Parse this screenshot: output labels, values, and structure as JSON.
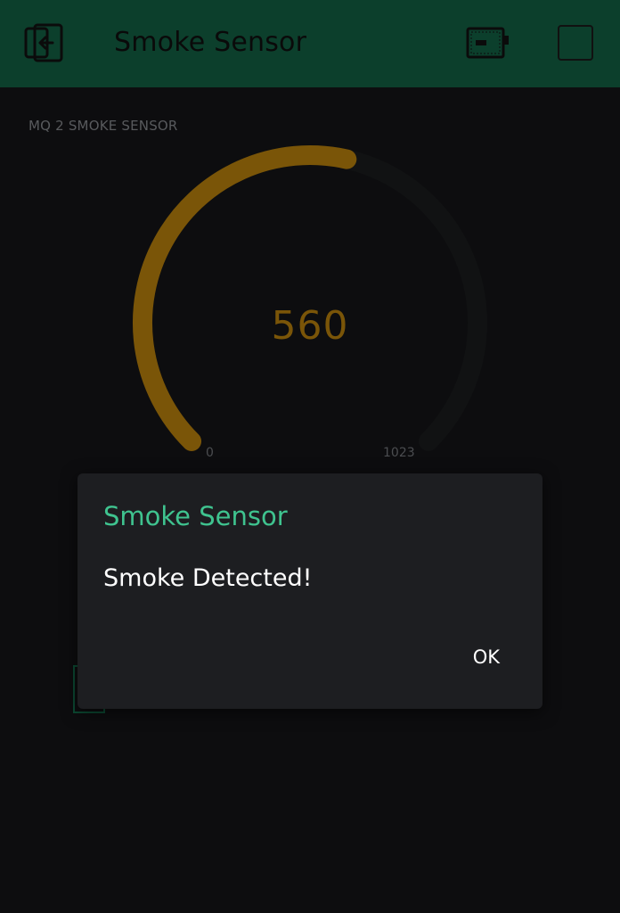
{
  "header": {
    "title": "Smoke Sensor",
    "back_icon": "exit-project-icon",
    "device_icon": "device-battery-icon",
    "stop_icon": "stop-square-icon",
    "background_color": "#0c3f2c"
  },
  "gauge_widget": {
    "label": "MQ 2 SMOKE SENSOR",
    "value": "560",
    "min_label": "0",
    "max_label": "1023",
    "fraction": 0.547,
    "fill_color": "#7a5508",
    "track_color": "#111213"
  },
  "dialog": {
    "title": "Smoke Sensor",
    "message": "Smoke Detected!",
    "ok_label": "OK",
    "title_color": "#3fc38f"
  }
}
